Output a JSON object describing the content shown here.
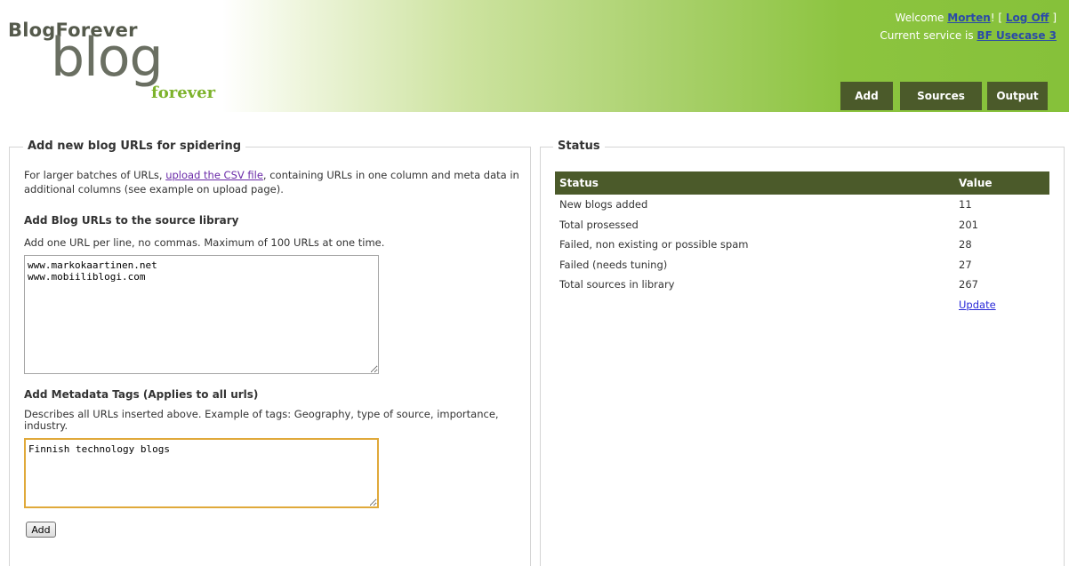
{
  "header": {
    "brand_text": "BlogForever",
    "logo_main": "blog",
    "logo_sub": "forever",
    "welcome_prefix": "Welcome ",
    "user": "Morten",
    "welcome_suffix": "! [ ",
    "logoff": "Log Off",
    "welcome_end": " ]",
    "service_prefix": "Current service is ",
    "service": "BF Usecase 3",
    "nav": [
      "Add",
      "Sources",
      "Output"
    ]
  },
  "add_panel": {
    "legend": "Add new blog URLs for spidering",
    "intro_before": "For larger batches of URLs, ",
    "intro_link": "upload the CSV file",
    "intro_after": ", containing URLs in one column and meta data in additional columns (see example on upload page).",
    "urls_heading": "Add Blog URLs to the source library",
    "urls_help": "Add one URL per line, no commas. Maximum of 100 URLs at one time.",
    "urls_value": "www.markokaartinen.net\nwww.mobiiliblogi.com",
    "tags_heading": "Add Metadata Tags (Applies to all urls)",
    "tags_help": "Describes all URLs inserted above. Example of tags: Geography, type of source, importance, industry.",
    "tags_value": "Finnish technology blogs",
    "add_button": "Add"
  },
  "status_panel": {
    "legend": "Status",
    "columns": [
      "Status",
      "Value"
    ],
    "rows": [
      [
        "New blogs added",
        "11"
      ],
      [
        "Total prosessed",
        "201"
      ],
      [
        "Failed, non existing or possible spam",
        "28"
      ],
      [
        "Failed (needs tuning)",
        "27"
      ],
      [
        "Total sources in library",
        "267"
      ]
    ],
    "update_link": "Update"
  },
  "colors": {
    "nav_bg": "#4b5a2a",
    "header_green": "#86c13a",
    "link_visited": "#6a2aa8",
    "focus_border": "#e0a93a"
  }
}
